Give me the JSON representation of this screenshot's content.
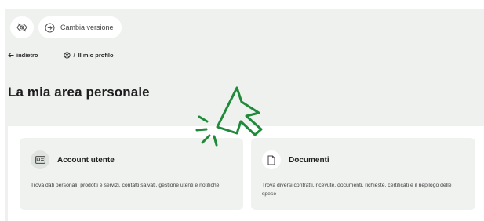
{
  "toolbar": {
    "visibility_icon": "eye-off-icon",
    "version_icon": "circle-arrow-right-icon",
    "version_label": "Cambia versione"
  },
  "nav": {
    "back_label": "indietro",
    "back_icon": "arrow-left-icon",
    "breadcrumb_icon": "settings-icon",
    "breadcrumb_separator": "/",
    "breadcrumb_current": "Il mio profilo"
  },
  "page": {
    "title": "La mia area personale"
  },
  "cards": [
    {
      "icon": "id-card-icon",
      "title": "Account utente",
      "description": "Trova dati personali, prodotti e servizi, contatti salvati, gestione utenti e notifiche"
    },
    {
      "icon": "document-icon",
      "title": "Documenti",
      "description": "Trova diversi contratti, ricevute, documenti, richieste, certificati e il riepilogo delle spese"
    }
  ],
  "overlay": {
    "icon": "click-cursor-icon",
    "color": "#1e8a3a"
  },
  "colors": {
    "background": "#eef1ee",
    "card": "#f0f2f0",
    "accent_green": "#1e8a3a"
  }
}
